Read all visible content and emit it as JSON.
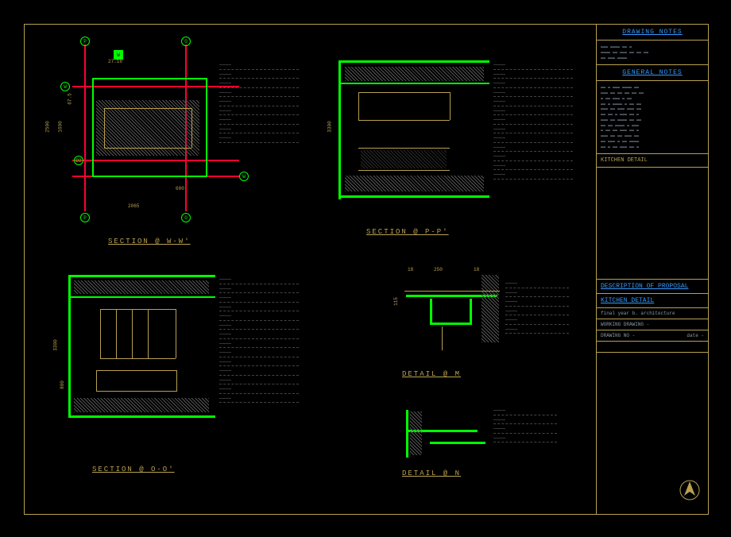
{
  "titleblock": {
    "drawing_notes_header": "DRAWING NOTES",
    "general_notes_header": "GENERAL NOTES",
    "drawing_title": "KITCHEN DETAIL",
    "description_header": "DESCRIPTION OF PROPOSAL",
    "description_value": "KITCHEN DETAIL",
    "studio": "final year b. architecture",
    "working_drawing": "WORKING DRAWING -",
    "drawing_no": "DRAWING NO -",
    "date_label": "date -"
  },
  "sections": {
    "ww": "SECTION  @  W-W'",
    "oo": "SECTION  @  O-O'",
    "pp": "SECTION  @  P-P'",
    "detail_m": "DETAIL  @  M",
    "detail_n": "DETAIL  @  N"
  },
  "dimensions": {
    "d_2500": "2500",
    "d_1600": "1600",
    "d_675": "67.5",
    "d_2718": "27.18",
    "d_600": "600",
    "d_2065": "2065",
    "d_3300": "3300",
    "d_800": "800",
    "d_115": "115",
    "d_18": "18",
    "d_250": "250",
    "d_18b": "18"
  },
  "grid": {
    "p": "P",
    "o": "O",
    "d2": "D2",
    "w": "W",
    "w2": "W"
  },
  "leader_placeholder": "—————"
}
